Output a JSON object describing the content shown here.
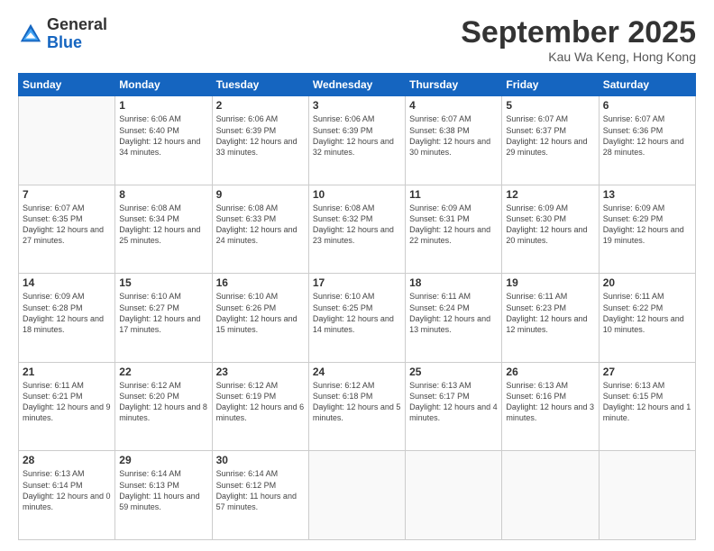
{
  "header": {
    "logo_general": "General",
    "logo_blue": "Blue",
    "month_title": "September 2025",
    "subtitle": "Kau Wa Keng, Hong Kong"
  },
  "weekdays": [
    "Sunday",
    "Monday",
    "Tuesday",
    "Wednesday",
    "Thursday",
    "Friday",
    "Saturday"
  ],
  "weeks": [
    [
      {
        "day": "",
        "info": ""
      },
      {
        "day": "1",
        "info": "Sunrise: 6:06 AM\nSunset: 6:40 PM\nDaylight: 12 hours\nand 34 minutes."
      },
      {
        "day": "2",
        "info": "Sunrise: 6:06 AM\nSunset: 6:39 PM\nDaylight: 12 hours\nand 33 minutes."
      },
      {
        "day": "3",
        "info": "Sunrise: 6:06 AM\nSunset: 6:39 PM\nDaylight: 12 hours\nand 32 minutes."
      },
      {
        "day": "4",
        "info": "Sunrise: 6:07 AM\nSunset: 6:38 PM\nDaylight: 12 hours\nand 30 minutes."
      },
      {
        "day": "5",
        "info": "Sunrise: 6:07 AM\nSunset: 6:37 PM\nDaylight: 12 hours\nand 29 minutes."
      },
      {
        "day": "6",
        "info": "Sunrise: 6:07 AM\nSunset: 6:36 PM\nDaylight: 12 hours\nand 28 minutes."
      }
    ],
    [
      {
        "day": "7",
        "info": "Sunrise: 6:07 AM\nSunset: 6:35 PM\nDaylight: 12 hours\nand 27 minutes."
      },
      {
        "day": "8",
        "info": "Sunrise: 6:08 AM\nSunset: 6:34 PM\nDaylight: 12 hours\nand 25 minutes."
      },
      {
        "day": "9",
        "info": "Sunrise: 6:08 AM\nSunset: 6:33 PM\nDaylight: 12 hours\nand 24 minutes."
      },
      {
        "day": "10",
        "info": "Sunrise: 6:08 AM\nSunset: 6:32 PM\nDaylight: 12 hours\nand 23 minutes."
      },
      {
        "day": "11",
        "info": "Sunrise: 6:09 AM\nSunset: 6:31 PM\nDaylight: 12 hours\nand 22 minutes."
      },
      {
        "day": "12",
        "info": "Sunrise: 6:09 AM\nSunset: 6:30 PM\nDaylight: 12 hours\nand 20 minutes."
      },
      {
        "day": "13",
        "info": "Sunrise: 6:09 AM\nSunset: 6:29 PM\nDaylight: 12 hours\nand 19 minutes."
      }
    ],
    [
      {
        "day": "14",
        "info": "Sunrise: 6:09 AM\nSunset: 6:28 PM\nDaylight: 12 hours\nand 18 minutes."
      },
      {
        "day": "15",
        "info": "Sunrise: 6:10 AM\nSunset: 6:27 PM\nDaylight: 12 hours\nand 17 minutes."
      },
      {
        "day": "16",
        "info": "Sunrise: 6:10 AM\nSunset: 6:26 PM\nDaylight: 12 hours\nand 15 minutes."
      },
      {
        "day": "17",
        "info": "Sunrise: 6:10 AM\nSunset: 6:25 PM\nDaylight: 12 hours\nand 14 minutes."
      },
      {
        "day": "18",
        "info": "Sunrise: 6:11 AM\nSunset: 6:24 PM\nDaylight: 12 hours\nand 13 minutes."
      },
      {
        "day": "19",
        "info": "Sunrise: 6:11 AM\nSunset: 6:23 PM\nDaylight: 12 hours\nand 12 minutes."
      },
      {
        "day": "20",
        "info": "Sunrise: 6:11 AM\nSunset: 6:22 PM\nDaylight: 12 hours\nand 10 minutes."
      }
    ],
    [
      {
        "day": "21",
        "info": "Sunrise: 6:11 AM\nSunset: 6:21 PM\nDaylight: 12 hours\nand 9 minutes."
      },
      {
        "day": "22",
        "info": "Sunrise: 6:12 AM\nSunset: 6:20 PM\nDaylight: 12 hours\nand 8 minutes."
      },
      {
        "day": "23",
        "info": "Sunrise: 6:12 AM\nSunset: 6:19 PM\nDaylight: 12 hours\nand 6 minutes."
      },
      {
        "day": "24",
        "info": "Sunrise: 6:12 AM\nSunset: 6:18 PM\nDaylight: 12 hours\nand 5 minutes."
      },
      {
        "day": "25",
        "info": "Sunrise: 6:13 AM\nSunset: 6:17 PM\nDaylight: 12 hours\nand 4 minutes."
      },
      {
        "day": "26",
        "info": "Sunrise: 6:13 AM\nSunset: 6:16 PM\nDaylight: 12 hours\nand 3 minutes."
      },
      {
        "day": "27",
        "info": "Sunrise: 6:13 AM\nSunset: 6:15 PM\nDaylight: 12 hours\nand 1 minute."
      }
    ],
    [
      {
        "day": "28",
        "info": "Sunrise: 6:13 AM\nSunset: 6:14 PM\nDaylight: 12 hours\nand 0 minutes."
      },
      {
        "day": "29",
        "info": "Sunrise: 6:14 AM\nSunset: 6:13 PM\nDaylight: 11 hours\nand 59 minutes."
      },
      {
        "day": "30",
        "info": "Sunrise: 6:14 AM\nSunset: 6:12 PM\nDaylight: 11 hours\nand 57 minutes."
      },
      {
        "day": "",
        "info": ""
      },
      {
        "day": "",
        "info": ""
      },
      {
        "day": "",
        "info": ""
      },
      {
        "day": "",
        "info": ""
      }
    ]
  ]
}
